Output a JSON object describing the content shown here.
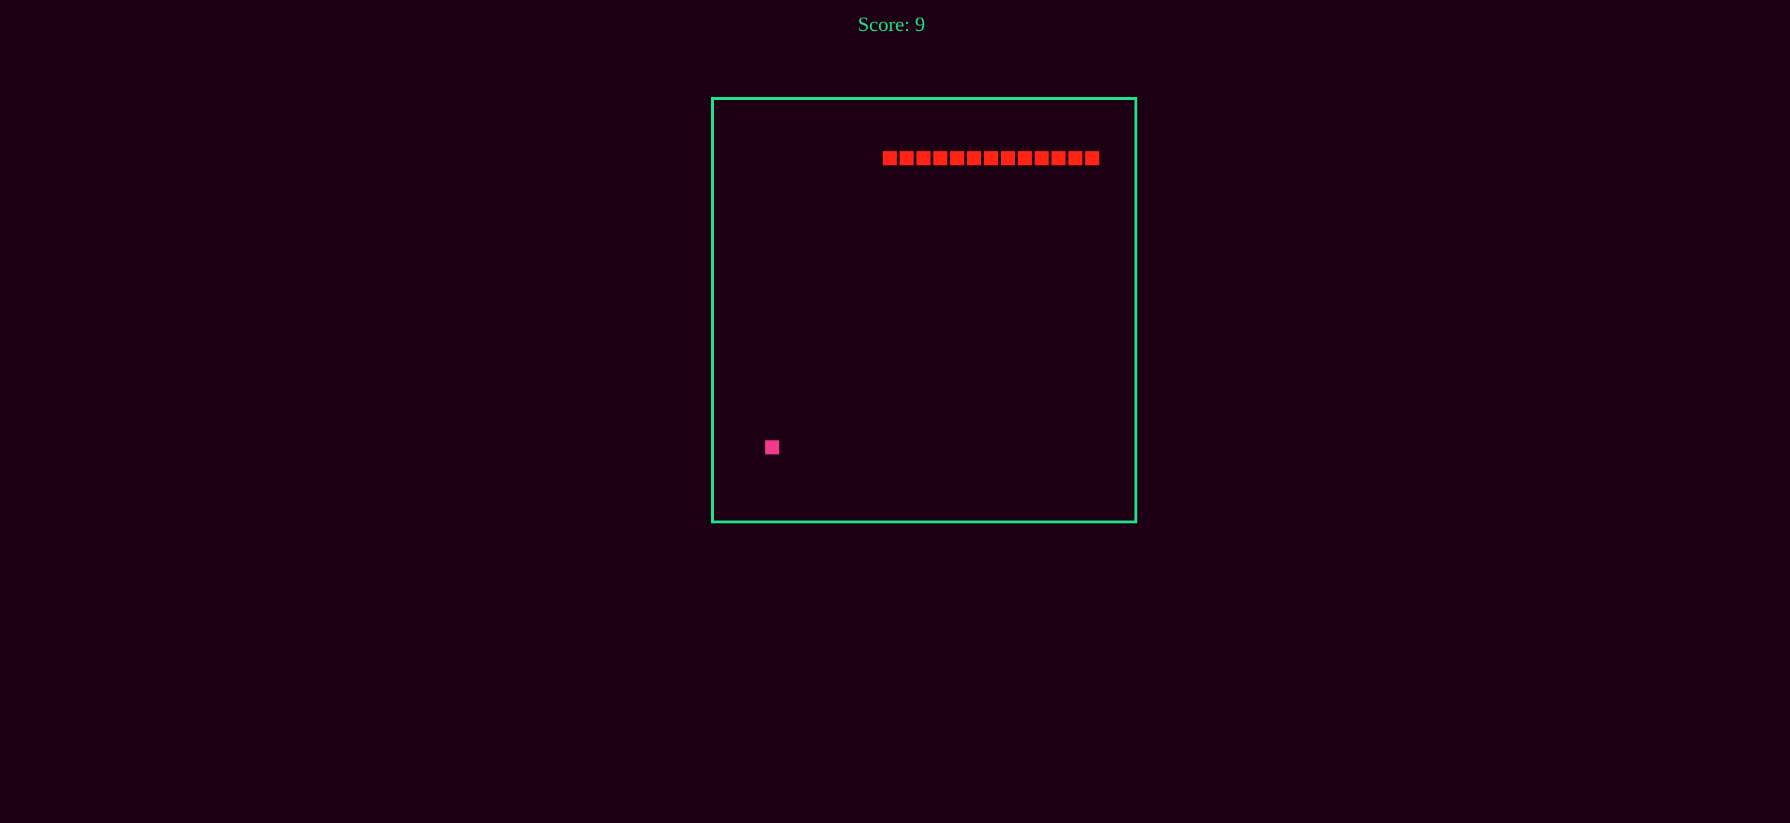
{
  "score": {
    "text": "Score: 9"
  },
  "game": {
    "grid_size": 25,
    "snake": [
      [
        10,
        3
      ],
      [
        11,
        3
      ],
      [
        12,
        3
      ],
      [
        13,
        3
      ],
      [
        14,
        3
      ],
      [
        15,
        3
      ],
      [
        16,
        3
      ],
      [
        17,
        3
      ],
      [
        18,
        3
      ],
      [
        19,
        3
      ],
      [
        20,
        3
      ],
      [
        21,
        3
      ],
      [
        22,
        3
      ]
    ],
    "food": [
      3,
      20
    ],
    "colors": {
      "background": "#1e0014",
      "board_border": "#1ee58c",
      "snake": "#ff2415",
      "food": "#f03a8e",
      "score_text": "#1ee58c"
    }
  }
}
